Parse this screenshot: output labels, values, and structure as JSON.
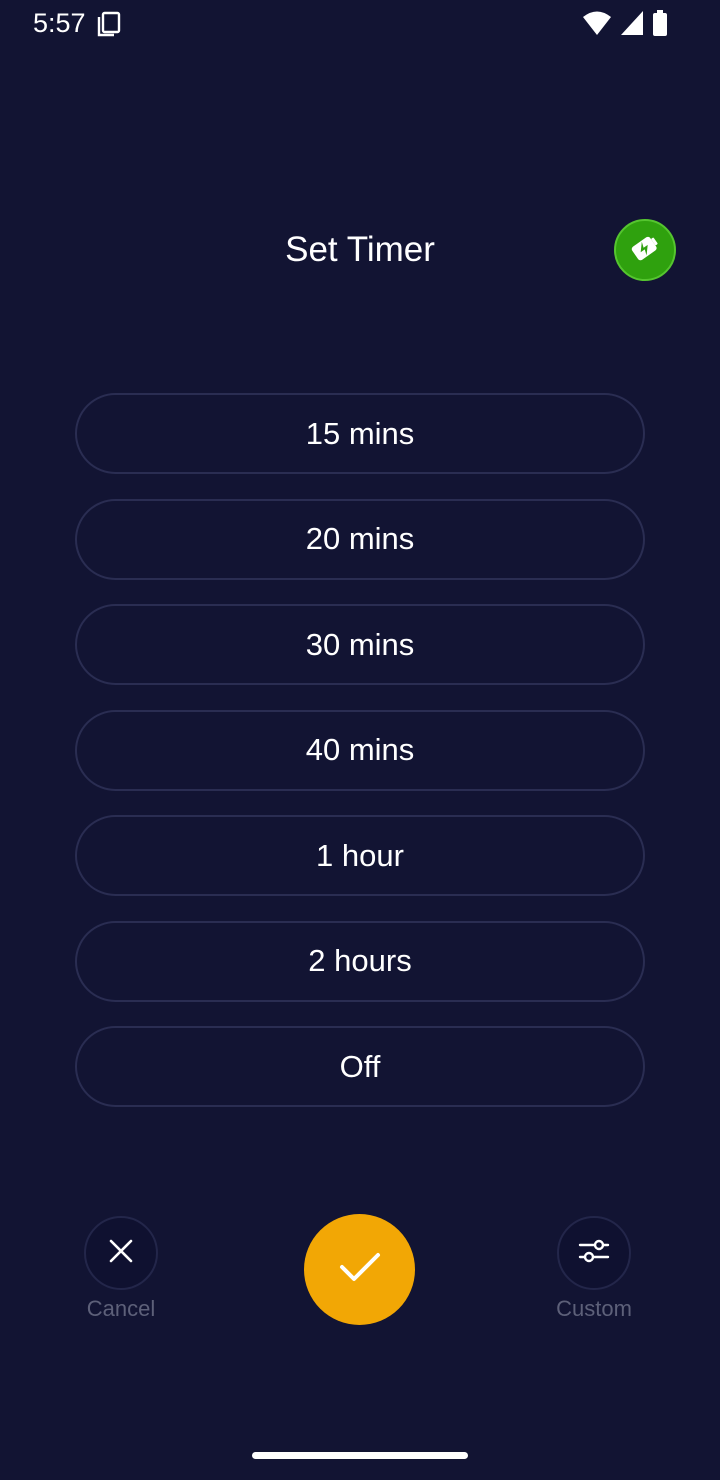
{
  "status_bar": {
    "time": "5:57",
    "icons": [
      "sim-card-icon",
      "wifi-icon",
      "signal-icon",
      "battery-icon"
    ]
  },
  "header": {
    "title": "Set Timer",
    "boost_icon": "battery-bolt-icon"
  },
  "options": [
    {
      "label": "15 mins"
    },
    {
      "label": "20 mins"
    },
    {
      "label": "30 mins"
    },
    {
      "label": "40 mins"
    },
    {
      "label": "1 hour"
    },
    {
      "label": "2 hours"
    },
    {
      "label": "Off"
    }
  ],
  "controls": {
    "cancel_label": "Cancel",
    "custom_label": "Custom",
    "confirm_icon": "check-icon"
  },
  "colors": {
    "background": "#121433",
    "accent": "#f2a705",
    "boost": "#2fa10e",
    "muted_text": "#5d6079"
  }
}
